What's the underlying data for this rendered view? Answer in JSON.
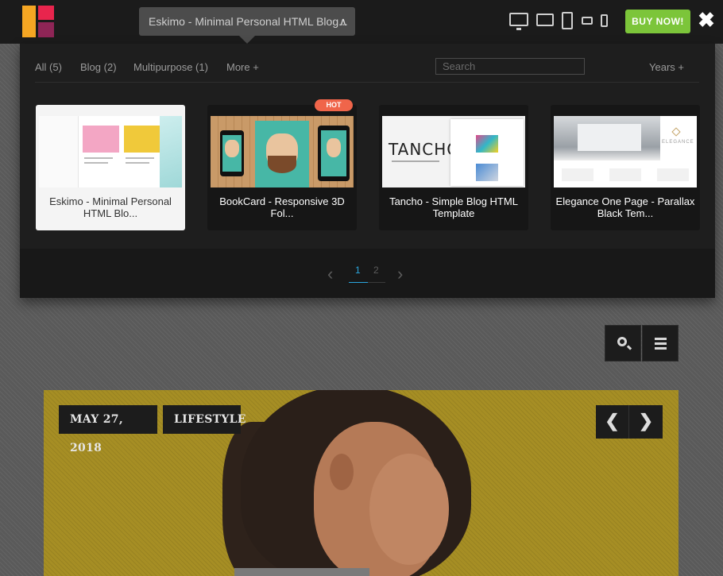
{
  "topbar": {
    "template_select": "Eskimo - Minimal Personal HTML Blog...",
    "buy_button": "BUY NOW!"
  },
  "filters": {
    "tabs": [
      {
        "label": "All (5)"
      },
      {
        "label": "Blog (2)"
      },
      {
        "label": "Multipurpose (1)"
      },
      {
        "label": "More +"
      }
    ],
    "search_placeholder": "Search",
    "years": "Years +"
  },
  "templates": [
    {
      "title": "Eskimo - Minimal Personal HTML Blo...",
      "active": true
    },
    {
      "title": "BookCard - Responsive 3D Fol...",
      "badge": "HOT"
    },
    {
      "title": "Tancho - Simple Blog HTML Template",
      "thumb_text": "TANCHO"
    },
    {
      "title": "Elegance One Page - Parallax Black Tem...",
      "thumb_text": "ELEGANCE"
    }
  ],
  "pager": {
    "current": "1",
    "other": "2"
  },
  "hero": {
    "date": "MAY 27, 2018",
    "category": "LIFESTYLE"
  },
  "colors": {
    "accent_green": "#7cc53a",
    "pager_active": "#2aa6de",
    "hot_badge": "#f0654a"
  },
  "icons": {
    "close": "close-icon",
    "search": "search-icon",
    "menu": "menu-icon",
    "prev": "chevron-left-icon",
    "next": "chevron-right-icon"
  }
}
